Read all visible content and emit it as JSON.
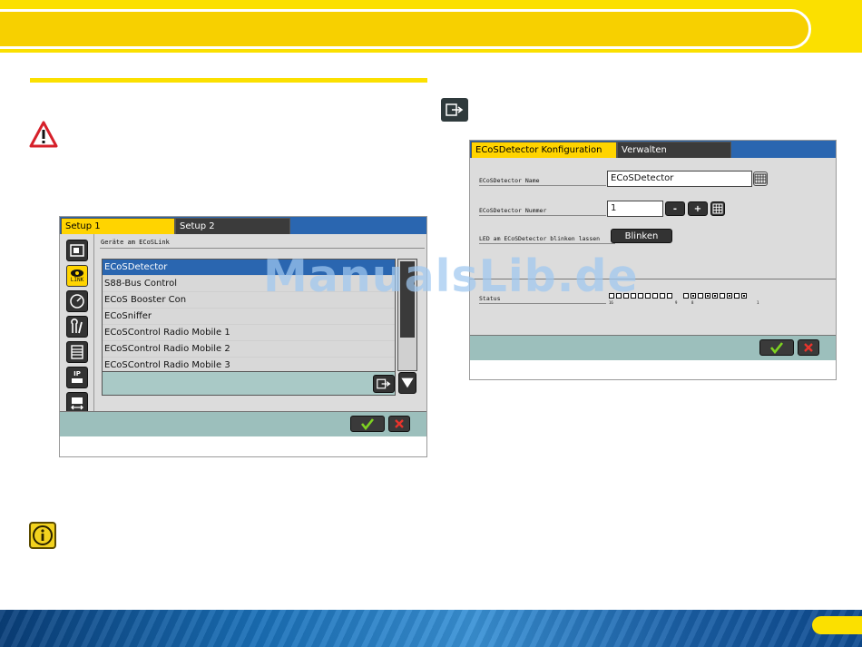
{
  "watermark": "ManualsLib.de",
  "screen1": {
    "tabs": [
      {
        "label": "Setup 1",
        "active": true
      },
      {
        "label": "Setup 2",
        "active": false
      }
    ],
    "heading": "Geräte am ECoSLink",
    "sidebar_icons": [
      "ecos-device-icon",
      "link-icon",
      "gauge-icon",
      "tools-icon",
      "list-icon",
      "ip-network-icon",
      "locomotive-ctrl-icon"
    ],
    "sidebar_link_text": "LINK",
    "sidebar_ip_text": "IP",
    "devices": [
      "ECoSDetector",
      "S88-Bus Control",
      "ECoS Booster Con",
      "ECoSniffer",
      "ECoSControl Radio Mobile 1",
      "ECoSControl Radio Mobile 2",
      "ECoSControl Radio Mobile 3"
    ],
    "selected_index": 0
  },
  "screen2": {
    "tabs": [
      {
        "label": "ECoSDetector Konfiguration",
        "active": true
      },
      {
        "label": "Verwalten",
        "active": false
      }
    ],
    "name_label": "ECoSDetector Name",
    "name_value": "ECoSDetector",
    "number_label": "ECoSDetector Nummer",
    "number_value": "1",
    "minus_label": "-",
    "plus_label": "+",
    "led_label": "LED am ECoSDetector blinken lassen",
    "blink_button": "Blinken",
    "status_label": "Status",
    "status_numbers": {
      "left": "16",
      "mid_a": "9",
      "mid_b": "8",
      "right": "1"
    },
    "status_group1": [
      0,
      0,
      0,
      0,
      0,
      0,
      0,
      0,
      0
    ],
    "status_group2": [
      0,
      1,
      0,
      1,
      1,
      0,
      1,
      0,
      1
    ]
  },
  "colors": {
    "accent_yellow": "#fbe000",
    "selection_blue": "#2a66b0",
    "footer_teal": "#9cbfbc",
    "ok_green": "#7ed321",
    "cancel_red": "#e8342c"
  }
}
